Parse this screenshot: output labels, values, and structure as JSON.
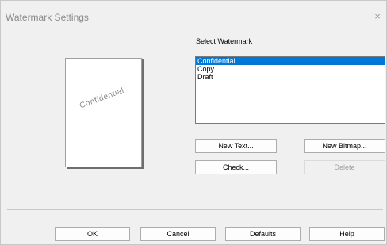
{
  "window": {
    "title": "Watermark Settings",
    "close_glyph": "×"
  },
  "preview": {
    "watermark_text": "Confidential"
  },
  "watermark_list": {
    "label": "Select Watermark",
    "items": [
      "Confidential",
      "Copy",
      "Draft"
    ],
    "selected_index": 0
  },
  "buttons": {
    "new_text": "New Text...",
    "new_bitmap": "New Bitmap...",
    "check": "Check...",
    "delete": "Delete",
    "ok": "OK",
    "cancel": "Cancel",
    "defaults": "Defaults",
    "help": "Help"
  },
  "colors": {
    "selection": "#0078d7",
    "window_bg": "#f0f0f0"
  }
}
